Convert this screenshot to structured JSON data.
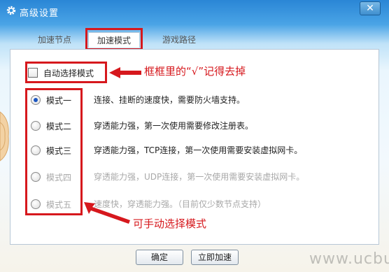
{
  "window": {
    "title": "高级设置",
    "close_label": "✕",
    "title_icon": "gear-icon"
  },
  "tabs": [
    {
      "label": "加速节点",
      "active": false
    },
    {
      "label": "加速模式",
      "active": true
    },
    {
      "label": "游戏路径",
      "active": false
    }
  ],
  "auto_select": {
    "label": "自动选择模式",
    "checked": false
  },
  "modes": [
    {
      "label": "模式一",
      "desc": "连接、挂断的速度快，需要防火墙支持。",
      "checked": true,
      "enabled": true
    },
    {
      "label": "模式二",
      "desc": "穿透能力强，第一次使用需要修改注册表。",
      "checked": false,
      "enabled": true
    },
    {
      "label": "模式三",
      "desc": "穿透能力强，TCP连接，第一次使用需要安装虚拟网卡。",
      "checked": false,
      "enabled": true
    },
    {
      "label": "模式四",
      "desc": "穿透能力强，UDP连接，第一次使用需要安装虚拟网卡。",
      "checked": false,
      "enabled": false
    },
    {
      "label": "模式五",
      "desc": "速度快，穿透能力强。（目前仅少数节点支持）",
      "checked": false,
      "enabled": false
    }
  ],
  "annotations": {
    "checkbox_note": "框框里的“√”记得去掉",
    "modes_note": "可手动选择模式",
    "color": "#d6181d"
  },
  "buttons": {
    "confirm": "确定",
    "accelerate": "立即加速"
  },
  "watermark": "www.ucbug.com"
}
